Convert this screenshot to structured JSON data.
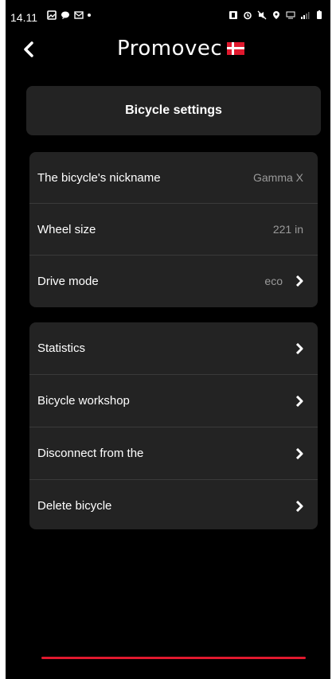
{
  "status_bar": {
    "time": "14.11"
  },
  "header": {
    "logo_text": "Promovec"
  },
  "page_title": "Bicycle settings",
  "settings": [
    {
      "label": "The bicycle's nickname",
      "value": "Gamma X"
    },
    {
      "label": "Wheel size",
      "value": "221 in"
    },
    {
      "label": "Drive mode",
      "value": "eco"
    }
  ],
  "menu": [
    {
      "label": "Statistics"
    },
    {
      "label": "Bicycle workshop"
    },
    {
      "label": "Disconnect from the"
    },
    {
      "label": "Delete bicycle"
    }
  ],
  "colors": {
    "accent": "#e0192e",
    "card": "#232323",
    "background": "#000000"
  }
}
